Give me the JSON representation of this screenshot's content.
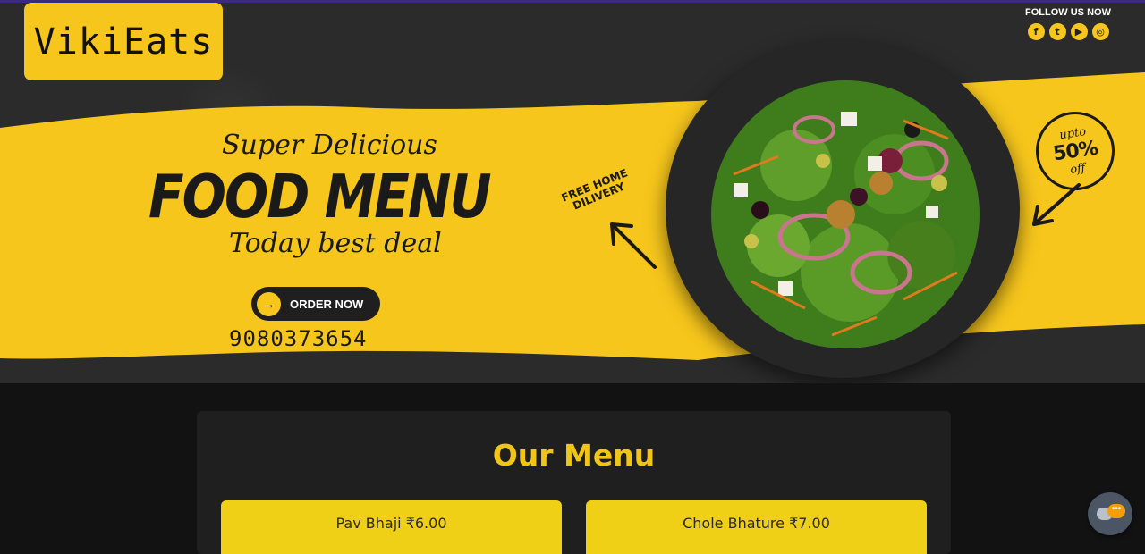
{
  "brand": {
    "logo_text": "VikiEats"
  },
  "social": {
    "label": "FOLLOW US NOW",
    "icons": [
      "facebook-icon",
      "twitter-icon",
      "youtube-icon",
      "instagram-icon"
    ],
    "glyphs": {
      "facebook": "f",
      "twitter": "t",
      "youtube": "▶",
      "instagram": "◎"
    }
  },
  "hero": {
    "super": "Super Delicious",
    "title": "FOOD MENU",
    "tagline": "Today best deal",
    "cta": "ORDER NOW",
    "cta_icon": "→",
    "phone": "9080373654",
    "free_line1": "FREE HOME",
    "free_line2": "DILIVERY",
    "offer_top": "upto",
    "offer_mid": "50%",
    "offer_bottom": "off"
  },
  "menu": {
    "title": "Our Menu",
    "items": [
      {
        "label": "Pav Bhaji ₹6.00"
      },
      {
        "label": "Chole Bhature ₹7.00"
      }
    ]
  },
  "colors": {
    "accent": "#f7c61c",
    "dark": "#1a1a1a",
    "title": "#f0c419",
    "item_bg": "#f0d017"
  }
}
